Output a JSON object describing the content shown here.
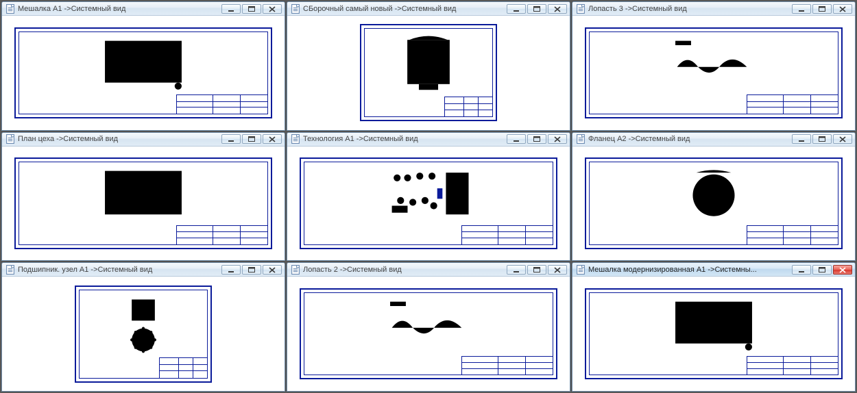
{
  "windows": [
    {
      "title": "Мешалка А1 ->Системный вид",
      "active": false,
      "orient": "landscape",
      "sketch": "mixer-zigzag"
    },
    {
      "title": "СБорочный самый новый ->Системный вид",
      "active": false,
      "orient": "portrait",
      "sketch": "assembly-vessel"
    },
    {
      "title": "Лопасть 3 ->Системный вид",
      "active": false,
      "orient": "landscape",
      "sketch": "blade-profile"
    },
    {
      "title": "План цеха ->Системный вид",
      "active": false,
      "orient": "landscape",
      "sketch": "floor-plan"
    },
    {
      "title": "Технология А1 ->Системный вид",
      "active": false,
      "orient": "landscape",
      "sketch": "process-flow"
    },
    {
      "title": "Фланец А2 ->Системный вид",
      "active": false,
      "orient": "landscape",
      "sketch": "flange-circle"
    },
    {
      "title": "Подшипник. узел А1 ->Системный вид",
      "active": false,
      "orient": "portrait",
      "sketch": "bearing-unit"
    },
    {
      "title": "Лопасть 2 ->Системный вид",
      "active": false,
      "orient": "landscape",
      "sketch": "blade-profile"
    },
    {
      "title": "Мешалка модернизированная А1 ->Системны...",
      "active": true,
      "orient": "landscape",
      "sketch": "mixer-zigzag"
    }
  ],
  "buttons": {
    "minimize": "minimize",
    "maximize": "maximize",
    "close": "close"
  }
}
